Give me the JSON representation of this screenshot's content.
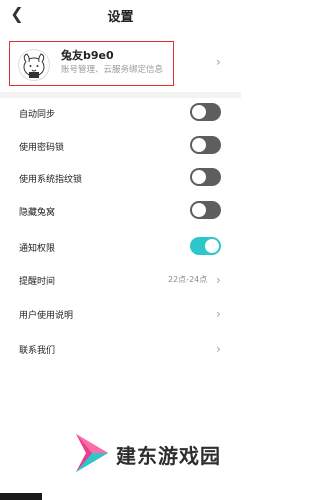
{
  "header": {
    "back_icon": "chevron-left-icon",
    "title": "设置"
  },
  "profile": {
    "name": "兔友b9e0",
    "description": "账号管理、云服务绑定信息",
    "chevron_icon": "chevron-right-icon"
  },
  "settings": [
    {
      "label": "自动同步",
      "type": "toggle",
      "on": false
    },
    {
      "label": "使用密码锁",
      "type": "toggle",
      "on": false
    },
    {
      "label": "使用系统指纹锁",
      "type": "toggle",
      "on": false
    },
    {
      "label": "隐藏兔窝",
      "type": "toggle",
      "on": false
    },
    {
      "label": "通知权限",
      "type": "toggle",
      "on": true
    },
    {
      "label": "提醒时间",
      "type": "value",
      "value": "22点-24点"
    },
    {
      "label": "用户使用说明",
      "type": "link"
    },
    {
      "label": "联系我们",
      "type": "link"
    }
  ],
  "watermark": {
    "text": "建东游戏园"
  },
  "colors": {
    "toggle_on": "#2ec7c9",
    "toggle_off": "#5e5e5e",
    "highlight_border": "#e0312f"
  }
}
